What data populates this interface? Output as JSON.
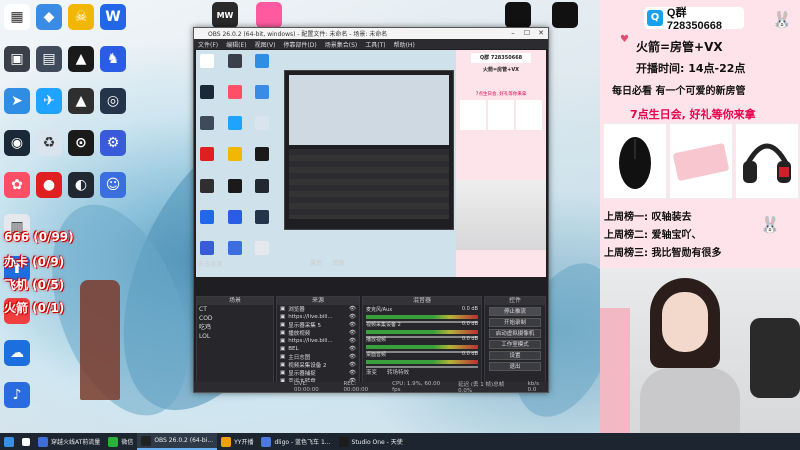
{
  "desktop": {
    "icons": [
      {
        "label": "",
        "color": "#ffffff",
        "glyph": "▦"
      },
      {
        "label": "",
        "color": "#3a3f4a",
        "glyph": "▣"
      },
      {
        "label": "",
        "color": "#2f8de4",
        "glyph": "➤"
      },
      {
        "label": "",
        "color": "#1b2838",
        "glyph": "◉"
      },
      {
        "label": "",
        "color": "#ff4f66",
        "glyph": "✿"
      },
      {
        "label": "",
        "color": "#3a8be6",
        "glyph": "◆"
      },
      {
        "label": "",
        "color": "#3f4a5a",
        "glyph": "▤"
      },
      {
        "label": "",
        "color": "#1ea4ff",
        "glyph": "✈"
      },
      {
        "label": "",
        "color": "#d9e4ee",
        "glyph": "♻"
      },
      {
        "label": "",
        "color": "#e02020",
        "glyph": "●"
      },
      {
        "label": "",
        "color": "#f2b705",
        "glyph": "☠"
      },
      {
        "label": "",
        "color": "#1a1a1a",
        "glyph": "▲"
      },
      {
        "label": "",
        "color": "#2f2f2f",
        "glyph": "▲"
      },
      {
        "label": "",
        "color": "#1a1a1a",
        "glyph": "⊙"
      },
      {
        "label": "",
        "color": "#222831",
        "glyph": "◐"
      },
      {
        "label": "",
        "color": "#2167e8",
        "glyph": "W"
      },
      {
        "label": "",
        "color": "#2b5ce6",
        "glyph": "♞"
      },
      {
        "label": "",
        "color": "#24344a",
        "glyph": "◎"
      },
      {
        "label": "",
        "color": "#3a5bd9",
        "glyph": "⚙"
      },
      {
        "label": "",
        "color": "#3b6fe0",
        "glyph": "☺"
      },
      {
        "label": "",
        "color": "#e5e9ee",
        "glyph": "▥"
      },
      {
        "label": "",
        "color": "#1d6fe0",
        "glyph": "⬆"
      },
      {
        "label": "",
        "color": "#ef3f3f",
        "glyph": "⛨"
      },
      {
        "label": "",
        "color": "#1d6fe0",
        "glyph": "☁"
      },
      {
        "label": "",
        "color": "#2b6be0",
        "glyph": "♪"
      }
    ],
    "top_icons": [
      {
        "label": "MW",
        "color": "#2a2a2a"
      },
      {
        "label": "",
        "color": "#ff5aa0"
      },
      {
        "label": "",
        "color": "#111111"
      },
      {
        "label": "",
        "color": "#111111"
      }
    ],
    "overlay_lines": [
      "666 (0/99)",
      "办卡 (0/9)",
      "飞机 (0/5)",
      "火箭 (0/1)"
    ]
  },
  "obs": {
    "title": "OBS 26.0.2 (64-bit, windows) - 配置文件: 未命名 - 场景: 未命名",
    "menu": [
      "文件(F)",
      "编辑(E)",
      "视图(V)",
      "停靠部件(D)",
      "场景集合(S)",
      "工具(T)",
      "帮助(H)"
    ],
    "no_source": "未选择源",
    "properties_btn": "属性",
    "filters_btn": "滤镜",
    "docks": {
      "scenes": "场景",
      "sources": "来源",
      "mixer": "混音器",
      "controls": "控件"
    },
    "scenes": [
      "CT",
      "COD",
      "吃鸡",
      "LOL"
    ],
    "sources": [
      "浏览器",
      "https://live.bili...",
      "显示器采集 5",
      "播放视频",
      "https://live.bili...",
      "BEL",
      "主日志图",
      "视频采集设备 2",
      "显示器捕捉",
      "幸运大转盘"
    ],
    "mixer": [
      {
        "name": "麦克风/Aux",
        "db": "0.0 dB"
      },
      {
        "name": "视频采集设备 2",
        "db": "0.0 dB"
      },
      {
        "name": "播放视频",
        "db": "0.0 dB"
      },
      {
        "name": "桌面音频",
        "db": "0.0 dB"
      }
    ],
    "controls": [
      "停止推流",
      "开始录制",
      "启动虚拟摄像机",
      "工作室模式",
      "设置",
      "退出"
    ],
    "transition": {
      "a": "渐变",
      "b": "转场特效"
    },
    "status": {
      "live": "LIVE: 00:00:00",
      "rec": "REC: 00:00:00",
      "cpu": "CPU: 1.9%, 60.00 fps",
      "kbps": "延迟 (丢 1 帧)总帧 0.0%",
      "fr": "kb/s 0.0"
    }
  },
  "panel": {
    "qq_label": "Q群 728350668",
    "line1": "火箭=房管+VX",
    "line2": "开播时间: 14点-22点",
    "line3": "每日必看 有一个可爱的新房管",
    "line4": "7点生日会, 好礼等你来拿",
    "rank1": "上周榜一: 叹轴装去",
    "rank2": "上周榜二: 爱轴宝吖、",
    "rank3": "上周榜三: 我比智勋有很多"
  },
  "taskbar": [
    {
      "label": "",
      "color": "#3b8fe0"
    },
    {
      "label": "",
      "color": "#ffffff"
    },
    {
      "label": "穿越火线AT前流量",
      "color": "#3c6fd8"
    },
    {
      "label": "微信",
      "color": "#2bb03b"
    },
    {
      "label": "OBS 26.0.2 (64-bi...",
      "color": "#222222"
    },
    {
      "label": "YY开播",
      "color": "#f0a000"
    },
    {
      "label": "dligo - 蓝色飞车 1...",
      "color": "#4a7ae0"
    },
    {
      "label": "Studio One - 天使",
      "color": "#1d1d1d"
    }
  ]
}
